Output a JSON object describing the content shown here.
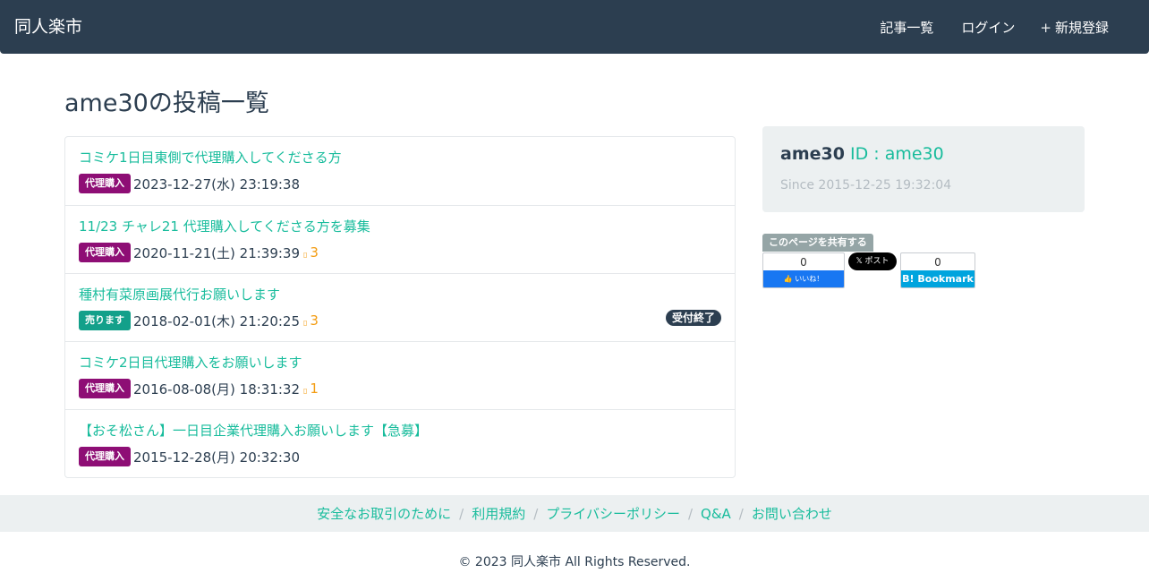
{
  "nav": {
    "brand": "同人楽市",
    "links": [
      {
        "icon": "",
        "label": "記事一覧",
        "icon_name": "list-icon"
      },
      {
        "icon": "",
        "label": "ログイン",
        "icon_name": "login-icon"
      },
      {
        "icon": "+",
        "label": "新規登録",
        "icon_name": "plus-icon"
      }
    ]
  },
  "page": {
    "title": "ame30の投稿一覧"
  },
  "colors": {
    "accent": "#18bc9c",
    "navbar": "#2c3e50",
    "badge_purchase": "#8e0e75",
    "badge_sell": "#13a08a",
    "comment": "#f39c12"
  },
  "posts": [
    {
      "title": "コミケ1日目東側で代理購入してくださる方",
      "badge": "代理購入",
      "badge_color": "#8e0e75",
      "date": "2023-12-27(水) 23:19:38",
      "comments": "",
      "status": ""
    },
    {
      "title": "11/23 チャレ21 代理購入してくださる方を募集",
      "badge": "代理購入",
      "badge_color": "#8e0e75",
      "date": "2020-11-21(土) 21:39:39",
      "comments": "3",
      "status": ""
    },
    {
      "title": "種村有菜原画展代行お願いします",
      "badge": "売ります",
      "badge_color": "#13a08a",
      "date": "2018-02-01(木) 21:20:25",
      "comments": "3",
      "status": "受付終了"
    },
    {
      "title": "コミケ2日目代理購入をお願いします",
      "badge": "代理購入",
      "badge_color": "#8e0e75",
      "date": "2016-08-08(月) 18:31:32",
      "comments": "1",
      "status": ""
    },
    {
      "title": "【おそ松さん】一日目企業代理購入お願いします【急募】",
      "badge": "代理購入",
      "badge_color": "#8e0e75",
      "date": "2015-12-28(月) 20:32:30",
      "comments": "",
      "status": ""
    }
  ],
  "profile": {
    "icon": "",
    "name": "ame30",
    "id_text": "ID : ame30",
    "since_icon": "",
    "since": "Since 2015-12-25 19:32:04"
  },
  "share": {
    "label": "このページを共有する",
    "fb_count": "0",
    "fb_button": "👍 いいね！",
    "x_button": "𝕏 ポスト",
    "hb_count": "0",
    "hb_button": "B! Bookmark"
  },
  "footer": {
    "links": [
      "安全なお取引のために",
      "利用規約",
      "プライバシーポリシー",
      "Q&A",
      "お問い合わせ"
    ],
    "separator": "/",
    "copyright": "© 2023 同人楽市 All Rights Reserved."
  }
}
